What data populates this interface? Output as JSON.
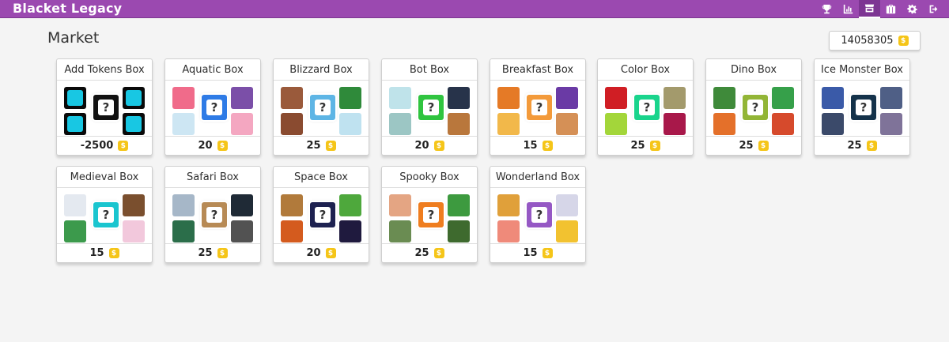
{
  "app": {
    "title": "Blacket Legacy"
  },
  "nav": [
    {
      "icon": "trophy-icon",
      "active": false
    },
    {
      "icon": "chart-icon",
      "active": false
    },
    {
      "icon": "market-icon",
      "active": true
    },
    {
      "icon": "briefcase-icon",
      "active": false
    },
    {
      "icon": "gear-icon",
      "active": false
    },
    {
      "icon": "logout-icon",
      "active": false
    }
  ],
  "page": {
    "title": "Market"
  },
  "tokens": {
    "value": "14058305"
  },
  "coin_symbol": "$",
  "boxes": [
    {
      "name": "Add Tokens Box",
      "price": "-2500",
      "color": "#111111",
      "tiles": [
        "#0a0a0a",
        "#0a0a0a",
        "#0a0a0a",
        "#0a0a0a"
      ],
      "accent": "#18c7e3"
    },
    {
      "name": "Aquatic Box",
      "price": "20",
      "color": "#2e7be6",
      "tiles": [
        "#f06b8a",
        "#7b4fa8",
        "#cde6f3",
        "#f4a7c1"
      ],
      "accent": ""
    },
    {
      "name": "Blizzard Box",
      "price": "25",
      "color": "#5eb5e5",
      "tiles": [
        "#9a5a3b",
        "#2f8a3a",
        "#8a4b30",
        "#bfe2f0"
      ],
      "accent": ""
    },
    {
      "name": "Bot Box",
      "price": "20",
      "color": "#2fc43f",
      "tiles": [
        "#bfe3ea",
        "#27334a",
        "#9cc6c4",
        "#b9773c"
      ],
      "accent": ""
    },
    {
      "name": "Breakfast Box",
      "price": "15",
      "color": "#f39a3a",
      "tiles": [
        "#e57a26",
        "#6a3aa5",
        "#f2b84a",
        "#d59056"
      ],
      "accent": ""
    },
    {
      "name": "Color Box",
      "price": "25",
      "color": "#19d48c",
      "tiles": [
        "#d01e24",
        "#a39a6c",
        "#a3d63a",
        "#a8184a"
      ],
      "accent": ""
    },
    {
      "name": "Dino Box",
      "price": "25",
      "color": "#92b536",
      "tiles": [
        "#3f8a3a",
        "#36a04a",
        "#e4702a",
        "#d64a2c"
      ],
      "accent": ""
    },
    {
      "name": "Ice Monster Box",
      "price": "25",
      "color": "#14324a",
      "tiles": [
        "#3a5aa8",
        "#4f5f86",
        "#3b4a6a",
        "#7f7399"
      ],
      "accent": ""
    },
    {
      "name": "Medieval Box",
      "price": "15",
      "color": "#1ac5cf",
      "tiles": [
        "#e4e9f0",
        "#7a4f2e",
        "#3c9a4c",
        "#f2c8dc"
      ],
      "accent": ""
    },
    {
      "name": "Safari Box",
      "price": "25",
      "color": "#b78a55",
      "tiles": [
        "#a6b7c8",
        "#1f2a36",
        "#2b6e4a",
        "#525252"
      ],
      "accent": ""
    },
    {
      "name": "Space Box",
      "price": "20",
      "color": "#1d2150",
      "tiles": [
        "#b17a3b",
        "#4ea83c",
        "#d45b1e",
        "#1f1a3e"
      ],
      "accent": ""
    },
    {
      "name": "Spooky Box",
      "price": "25",
      "color": "#ef7d1f",
      "tiles": [
        "#e4a583",
        "#3d9a3f",
        "#6a8c52",
        "#3e6a2e"
      ],
      "accent": ""
    },
    {
      "name": "Wonderland Box",
      "price": "15",
      "color": "#9558c4",
      "tiles": [
        "#e0a03a",
        "#d6d6e8",
        "#ef8a7a",
        "#f2c230"
      ],
      "accent": ""
    }
  ]
}
